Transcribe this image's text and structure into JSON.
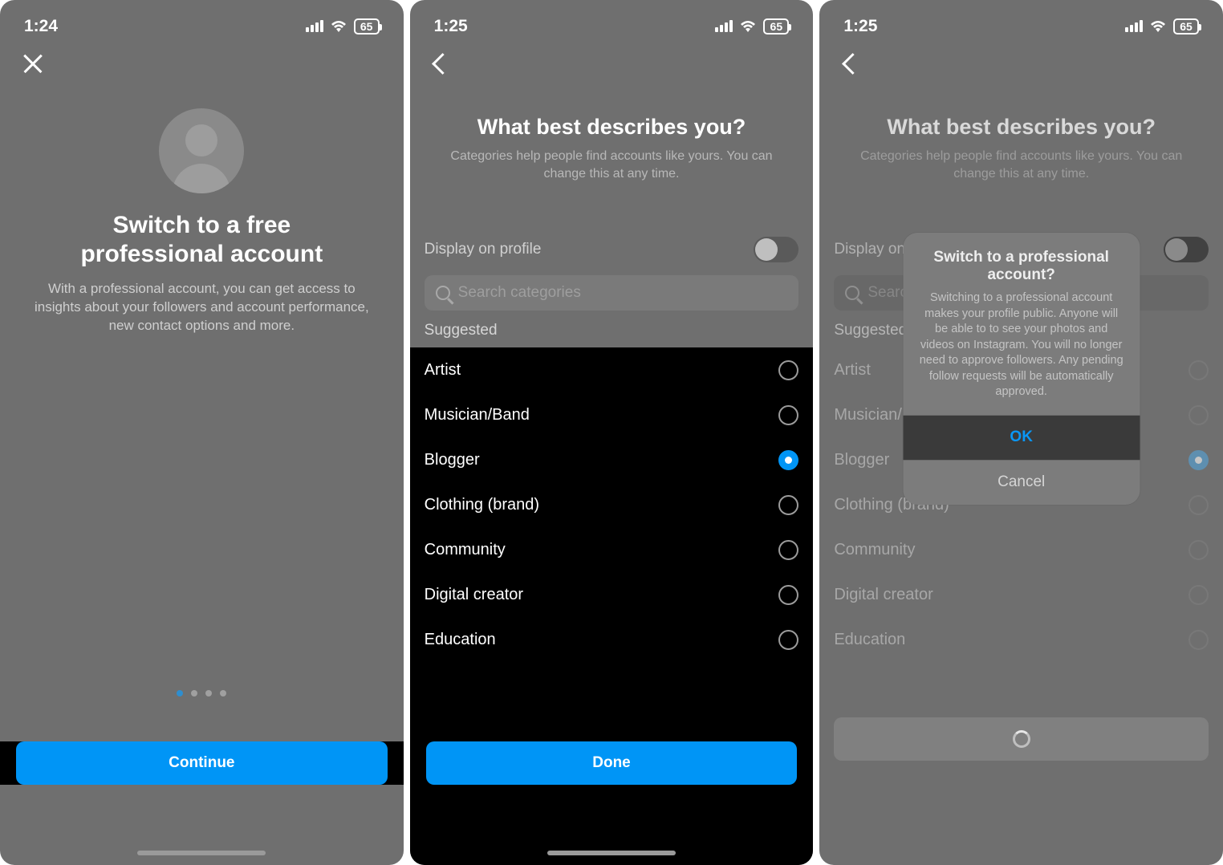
{
  "status": {
    "time_s1": "1:24",
    "time_s2": "1:25",
    "time_s3": "1:25",
    "battery": "65"
  },
  "screen1": {
    "title_line1": "Switch to a free",
    "title_line2": "professional account",
    "description": "With a professional account, you can get access to insights about your followers and account performance, new contact options and more.",
    "continue": "Continue",
    "page_dots": {
      "total": 4,
      "active_index": 0
    }
  },
  "screen2": {
    "title": "What best describes you?",
    "subtitle": "Categories help people find accounts like yours. You can change this at any time.",
    "display_on_profile": "Display on profile",
    "search_placeholder": "Search categories",
    "suggested_label": "Suggested",
    "categories": [
      {
        "label": "Artist",
        "selected": false
      },
      {
        "label": "Musician/Band",
        "selected": false
      },
      {
        "label": "Blogger",
        "selected": true
      },
      {
        "label": "Clothing (brand)",
        "selected": false
      },
      {
        "label": "Community",
        "selected": false
      },
      {
        "label": "Digital creator",
        "selected": false
      },
      {
        "label": "Education",
        "selected": false
      }
    ],
    "done": "Done"
  },
  "screen3": {
    "alert_title": "Switch to a professional account?",
    "alert_body": "Switching to a professional account makes your profile public. Anyone will be able to to see your photos and videos on Instagram. You will no longer need to approve followers. Any pending follow requests will be automatically approved.",
    "ok": "OK",
    "cancel": "Cancel"
  },
  "colors": {
    "accent_blue": "#0095f6"
  }
}
